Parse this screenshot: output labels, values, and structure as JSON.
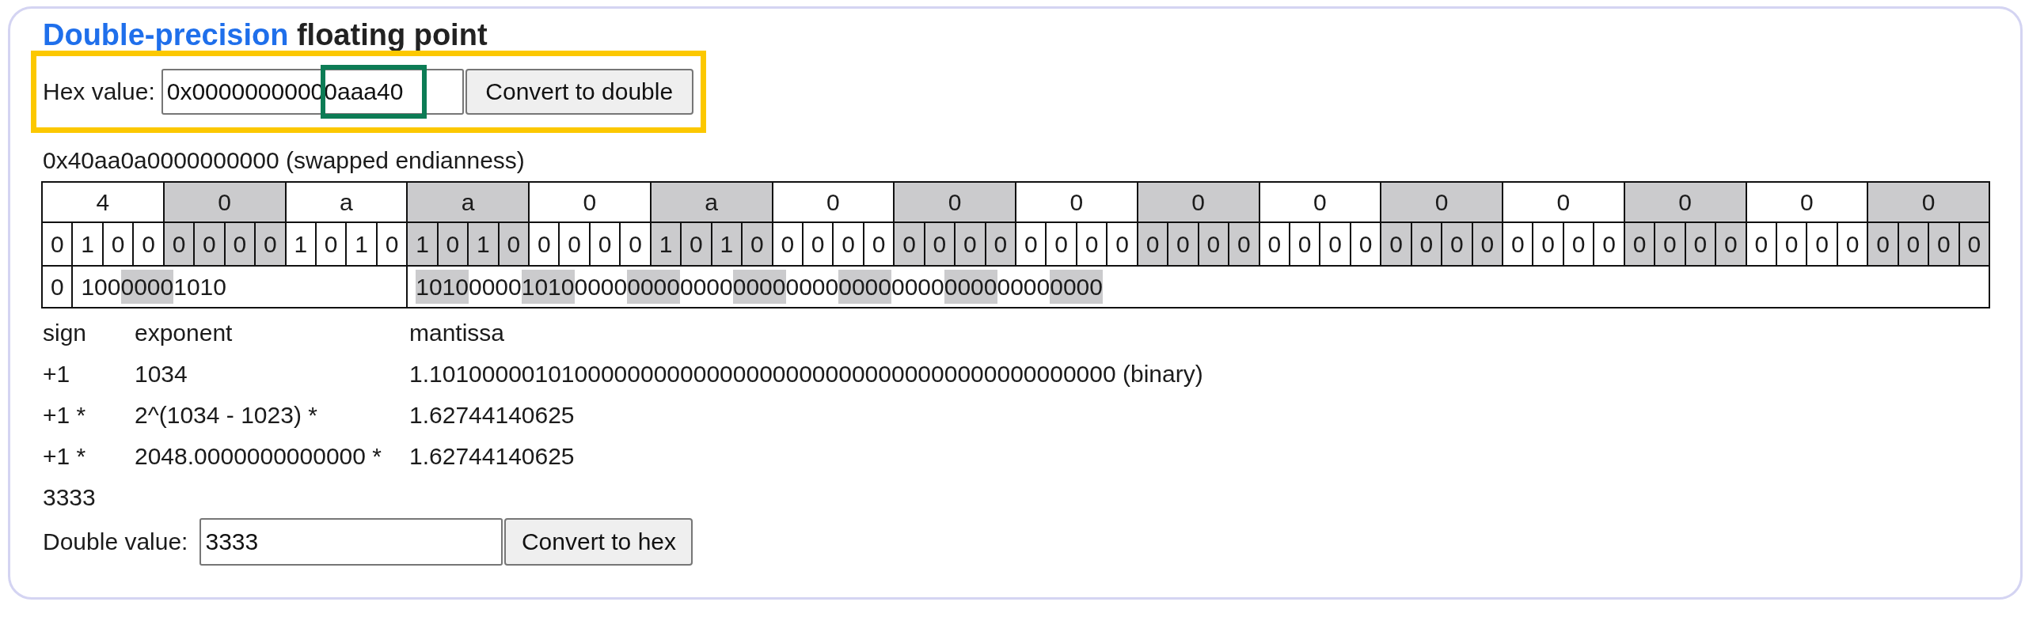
{
  "title": {
    "link": "Double-precision",
    "text": "floating point"
  },
  "hex_row": {
    "framed": true,
    "label": "Hex value:",
    "value": "0x00000000000aaa40",
    "value_marked": true,
    "button": "Convert to double"
  },
  "swapped_hex": "0x40aa0a0000000000 (swapped endianness)",
  "table": {
    "nibbles": [
      {
        "hex": "4",
        "shaded": false,
        "bits": [
          "0",
          "1",
          "0",
          "0"
        ]
      },
      {
        "hex": "0",
        "shaded": true,
        "bits": [
          "0",
          "0",
          "0",
          "0"
        ]
      },
      {
        "hex": "a",
        "shaded": false,
        "bits": [
          "1",
          "0",
          "1",
          "0"
        ]
      },
      {
        "hex": "a",
        "shaded": true,
        "bits": [
          "1",
          "0",
          "1",
          "0"
        ]
      },
      {
        "hex": "0",
        "shaded": false,
        "bits": [
          "0",
          "0",
          "0",
          "0"
        ]
      },
      {
        "hex": "a",
        "shaded": true,
        "bits": [
          "1",
          "0",
          "1",
          "0"
        ]
      },
      {
        "hex": "0",
        "shaded": false,
        "bits": [
          "0",
          "0",
          "0",
          "0"
        ]
      },
      {
        "hex": "0",
        "shaded": true,
        "bits": [
          "0",
          "0",
          "0",
          "0"
        ]
      },
      {
        "hex": "0",
        "shaded": false,
        "bits": [
          "0",
          "0",
          "0",
          "0"
        ]
      },
      {
        "hex": "0",
        "shaded": true,
        "bits": [
          "0",
          "0",
          "0",
          "0"
        ]
      },
      {
        "hex": "0",
        "shaded": false,
        "bits": [
          "0",
          "0",
          "0",
          "0"
        ]
      },
      {
        "hex": "0",
        "shaded": true,
        "bits": [
          "0",
          "0",
          "0",
          "0"
        ]
      },
      {
        "hex": "0",
        "shaded": false,
        "bits": [
          "0",
          "0",
          "0",
          "0"
        ]
      },
      {
        "hex": "0",
        "shaded": true,
        "bits": [
          "0",
          "0",
          "0",
          "0"
        ]
      },
      {
        "hex": "0",
        "shaded": false,
        "bits": [
          "0",
          "0",
          "0",
          "0"
        ]
      },
      {
        "hex": "0",
        "shaded": true,
        "bits": [
          "0",
          "0",
          "0",
          "0"
        ]
      }
    ],
    "sign": "0",
    "exponent": [
      {
        "text": "100",
        "shaded": false
      },
      {
        "text": "0000",
        "shaded": true
      },
      {
        "text": "1010",
        "shaded": false
      }
    ],
    "mantissa": [
      {
        "text": "1010",
        "shaded": true
      },
      {
        "text": "0000",
        "shaded": false
      },
      {
        "text": "1010",
        "shaded": true
      },
      {
        "text": "0000",
        "shaded": false
      },
      {
        "text": "0000",
        "shaded": true
      },
      {
        "text": "0000",
        "shaded": false
      },
      {
        "text": "0000",
        "shaded": true
      },
      {
        "text": "0000",
        "shaded": false
      },
      {
        "text": "0000",
        "shaded": true
      },
      {
        "text": "0000",
        "shaded": false
      },
      {
        "text": "0000",
        "shaded": true
      },
      {
        "text": "0000",
        "shaded": false
      },
      {
        "text": "0000",
        "shaded": true
      }
    ]
  },
  "breakdown": {
    "headers": {
      "sign": "sign",
      "exponent": "exponent",
      "mantissa": "mantissa"
    },
    "rows": [
      {
        "sign": "+1",
        "exponent": "1034",
        "mantissa": "1.1010000010100000000000000000000000000000000000000000 (binary)"
      },
      {
        "sign": "+1 *",
        "exponent": "2^(1034 - 1023) *",
        "mantissa": "1.62744140625"
      },
      {
        "sign": "+1 *",
        "exponent": "2048.0000000000000 *",
        "mantissa": "1.62744140625"
      }
    ]
  },
  "result": "3333",
  "double_row": {
    "label": "Double value:",
    "value": "3333",
    "button": "Convert to hex"
  }
}
